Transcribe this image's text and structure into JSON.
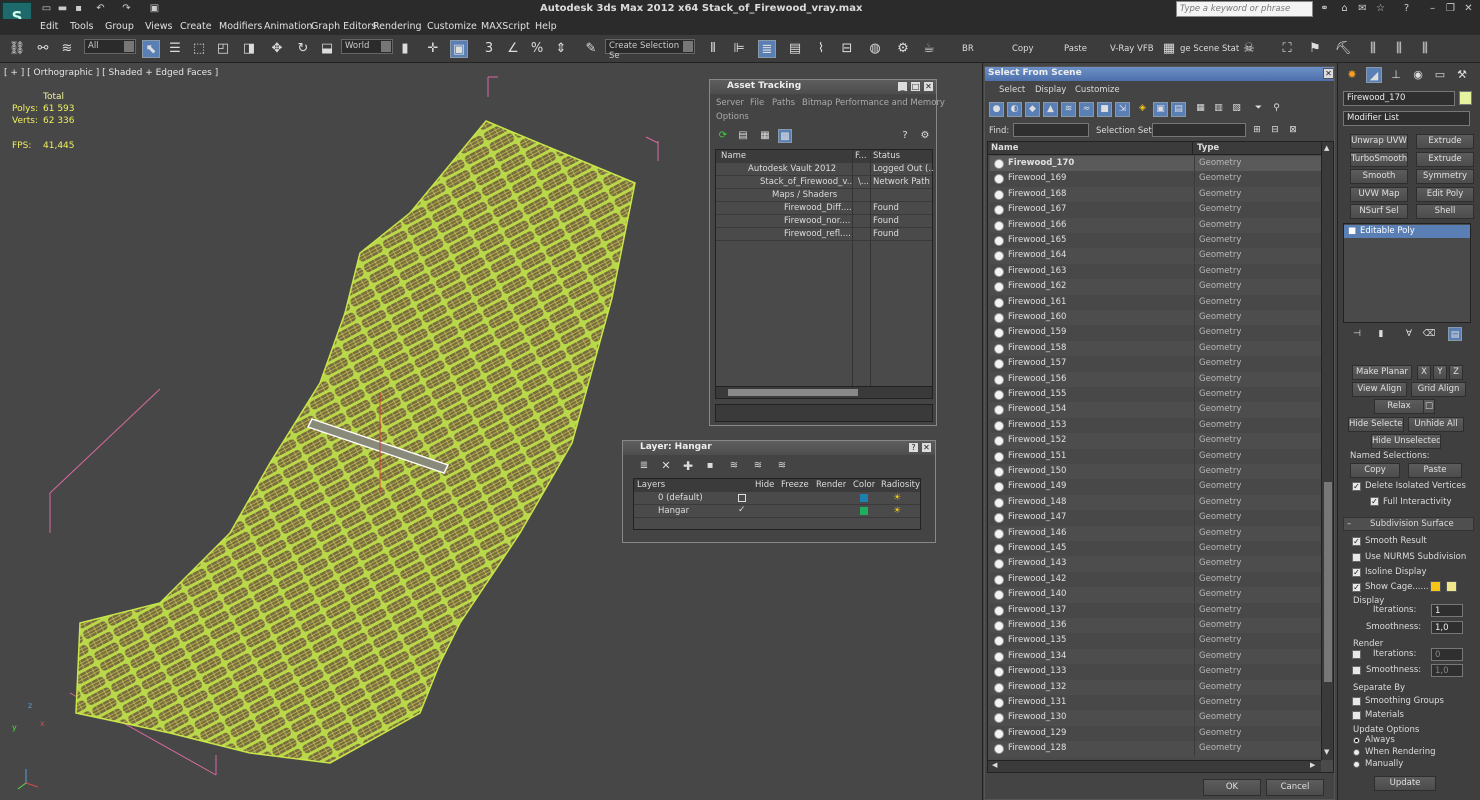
{
  "app": {
    "title": "Autodesk 3ds Max  2012 x64     Stack_of_Firewood_vray.max",
    "search_placeholder": "Type a keyword or phrase",
    "logo_letter": "S"
  },
  "menu": [
    "Edit",
    "Tools",
    "Group",
    "Views",
    "Create",
    "Modifiers",
    "Animation",
    "Graph Editors",
    "Rendering",
    "Customize",
    "MAXScript",
    "Help"
  ],
  "toolbar": {
    "filter_value": "All",
    "coord_value": "World",
    "selection_set_placeholder": "Create Selection Se",
    "br_label": "BR",
    "copy_label": "Copy",
    "paste_label": "Paste",
    "vray_vfb_label": "V-Ray VFB",
    "scene_states_label": "ge Scene Stat",
    "snap_label": "3",
    "angle_label": "∠",
    "percent_label": "%"
  },
  "viewport": {
    "label": "[ + ] [ Orthographic ] [ Shaded + Edged Faces ]",
    "stats_total_label": "Total",
    "polys_label": "Polys:",
    "polys_value": "61 593",
    "verts_label": "Verts:",
    "verts_value": "62 336",
    "fps_label": "FPS:",
    "fps_value": "41,445",
    "axis_x": "x",
    "axis_y": "y",
    "axis_z": "z"
  },
  "asset_tracking": {
    "title": "Asset Tracking",
    "menu": [
      "Server",
      "File",
      "Paths",
      "Bitmap Performance and Memory",
      "Options"
    ],
    "columns": [
      "Name",
      "F...",
      "Status"
    ],
    "rows": [
      {
        "name": "Autodesk Vault 2012",
        "f": "",
        "status": "Logged Out (..."
      },
      {
        "name": "Stack_of_Firewood_v...",
        "f": "\\...",
        "status": "Network Path"
      },
      {
        "name": "Maps / Shaders",
        "f": "",
        "status": ""
      },
      {
        "name": "Firewood_Diff....",
        "f": "",
        "status": "Found"
      },
      {
        "name": "Firewood_nor....",
        "f": "",
        "status": "Found"
      },
      {
        "name": "Firewood_refl....",
        "f": "",
        "status": "Found"
      }
    ]
  },
  "layer_window": {
    "title": "Layer: Hangar",
    "columns": [
      "Layers",
      "Hide",
      "Freeze",
      "Render",
      "Color",
      "Radiosity"
    ],
    "rows": [
      {
        "name": "0 (default)",
        "color": "#1f7fb0"
      },
      {
        "name": "Hangar",
        "color": "#1db060"
      }
    ]
  },
  "select_from_scene": {
    "title": "Select From Scene",
    "menu": [
      "Select",
      "Display",
      "Customize"
    ],
    "find_label": "Find:",
    "find_value": "",
    "selection_set_label": "Selection Set:",
    "selection_set_value": "",
    "col_name": "Name",
    "col_type": "Type",
    "rows": [
      {
        "name": "Firewood_170",
        "type": "Geometry"
      },
      {
        "name": "Firewood_169",
        "type": "Geometry"
      },
      {
        "name": "Firewood_168",
        "type": "Geometry"
      },
      {
        "name": "Firewood_167",
        "type": "Geometry"
      },
      {
        "name": "Firewood_166",
        "type": "Geometry"
      },
      {
        "name": "Firewood_165",
        "type": "Geometry"
      },
      {
        "name": "Firewood_164",
        "type": "Geometry"
      },
      {
        "name": "Firewood_163",
        "type": "Geometry"
      },
      {
        "name": "Firewood_162",
        "type": "Geometry"
      },
      {
        "name": "Firewood_161",
        "type": "Geometry"
      },
      {
        "name": "Firewood_160",
        "type": "Geometry"
      },
      {
        "name": "Firewood_159",
        "type": "Geometry"
      },
      {
        "name": "Firewood_158",
        "type": "Geometry"
      },
      {
        "name": "Firewood_157",
        "type": "Geometry"
      },
      {
        "name": "Firewood_156",
        "type": "Geometry"
      },
      {
        "name": "Firewood_155",
        "type": "Geometry"
      },
      {
        "name": "Firewood_154",
        "type": "Geometry"
      },
      {
        "name": "Firewood_153",
        "type": "Geometry"
      },
      {
        "name": "Firewood_152",
        "type": "Geometry"
      },
      {
        "name": "Firewood_151",
        "type": "Geometry"
      },
      {
        "name": "Firewood_150",
        "type": "Geometry"
      },
      {
        "name": "Firewood_149",
        "type": "Geometry"
      },
      {
        "name": "Firewood_148",
        "type": "Geometry"
      },
      {
        "name": "Firewood_147",
        "type": "Geometry"
      },
      {
        "name": "Firewood_146",
        "type": "Geometry"
      },
      {
        "name": "Firewood_145",
        "type": "Geometry"
      },
      {
        "name": "Firewood_143",
        "type": "Geometry"
      },
      {
        "name": "Firewood_142",
        "type": "Geometry"
      },
      {
        "name": "Firewood_140",
        "type": "Geometry"
      },
      {
        "name": "Firewood_137",
        "type": "Geometry"
      },
      {
        "name": "Firewood_136",
        "type": "Geometry"
      },
      {
        "name": "Firewood_135",
        "type": "Geometry"
      },
      {
        "name": "Firewood_134",
        "type": "Geometry"
      },
      {
        "name": "Firewood_133",
        "type": "Geometry"
      },
      {
        "name": "Firewood_132",
        "type": "Geometry"
      },
      {
        "name": "Firewood_131",
        "type": "Geometry"
      },
      {
        "name": "Firewood_130",
        "type": "Geometry"
      },
      {
        "name": "Firewood_129",
        "type": "Geometry"
      },
      {
        "name": "Firewood_128",
        "type": "Geometry"
      }
    ],
    "ok_label": "OK",
    "cancel_label": "Cancel"
  },
  "command_panel": {
    "object_name": "Firewood_170",
    "object_color": "#e6f2a0",
    "modifier_list_label": "Modifier List",
    "modifier_buttons": [
      "Unwrap UVW",
      "Extrude",
      "TurboSmooth",
      "Extrude",
      "Smooth",
      "Symmetry",
      "UVW Map",
      "Edit Poly",
      "NSurf Sel",
      "Shell"
    ],
    "stack_item": "Editable Poly",
    "make_planar": "Make Planar",
    "x": "X",
    "y": "Y",
    "z": "Z",
    "view_align": "View Align",
    "grid_align": "Grid Align",
    "relax": "Relax",
    "hide_selected": "Hide Selected",
    "unhide_all": "Unhide All",
    "hide_unselected": "Hide Unselected",
    "named_selections": "Named Selections:",
    "copy": "Copy",
    "paste": "Paste",
    "delete_isolated": "Delete Isolated Vertices",
    "full_interactivity": "Full Interactivity",
    "subdivision_surface": "Subdivision Surface",
    "smooth_result": "Smooth Result",
    "use_nurms": "Use NURMS Subdivision",
    "isoline_display": "Isoline Display",
    "show_cage": "Show Cage......",
    "display_group": "Display",
    "iterations_label": "Iterations:",
    "iterations_value": "1",
    "smoothness_label": "Smoothness:",
    "smoothness_value": "1,0",
    "render_group": "Render",
    "render_iterations_value": "0",
    "render_smoothness_value": "1,0",
    "separate_by": "Separate By",
    "smoothing_groups": "Smoothing Groups",
    "materials": "Materials",
    "update_options": "Update Options",
    "always": "Always",
    "when_rendering": "When Rendering",
    "manually": "Manually",
    "update": "Update",
    "cage_color_1": "#f5c518",
    "cage_color_2": "#f0e68c"
  }
}
